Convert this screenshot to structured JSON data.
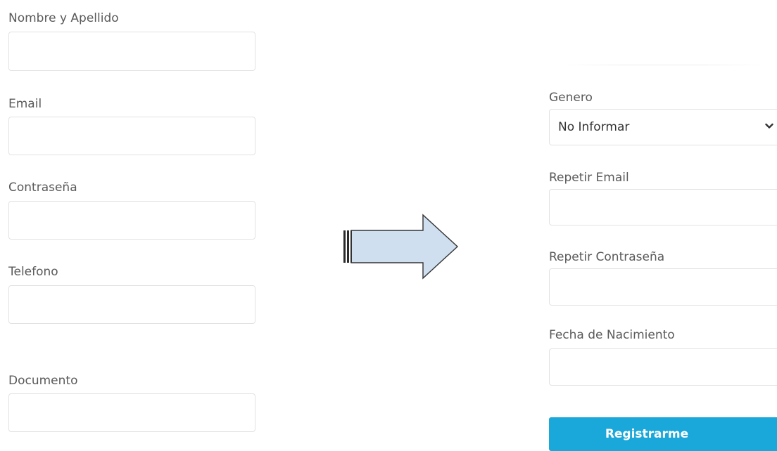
{
  "left_form": {
    "nombre": {
      "label": "Nombre y Apellido",
      "value": ""
    },
    "email": {
      "label": "Email",
      "value": ""
    },
    "contrasena": {
      "label": "Contraseña",
      "value": ""
    },
    "telefono": {
      "label": "Telefono",
      "value": ""
    },
    "documento": {
      "label": "Documento",
      "value": ""
    }
  },
  "right_form": {
    "genero": {
      "label": "Genero",
      "selected": "No Informar"
    },
    "repetir_email": {
      "label": "Repetir Email",
      "value": ""
    },
    "repetir_contrasena": {
      "label": "Repetir Contraseña",
      "value": ""
    },
    "fecha_nacimiento": {
      "label": "Fecha de Nacimiento",
      "value": ""
    },
    "submit_label": "Registrarme"
  },
  "icons": {
    "arrow": "right-arrow-icon",
    "chevron": "chevron-down-icon"
  },
  "colors": {
    "button": "#1aa7d9",
    "arrow_fill": "#cfdff0",
    "field_border": "#e2e2e2"
  }
}
